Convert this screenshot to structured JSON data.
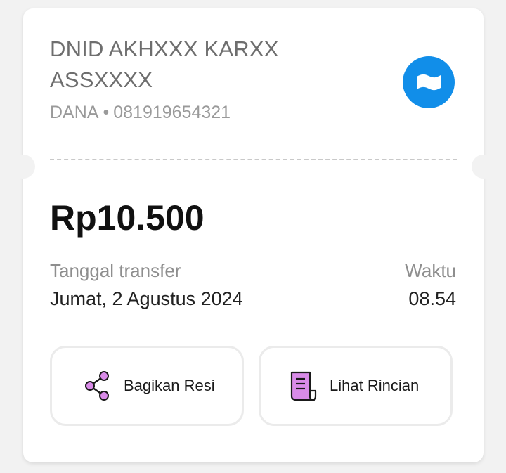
{
  "recipient": {
    "name": "DNID AKHXXX KARXX ASSXXXX",
    "wallet": "DANA",
    "separator": "•",
    "phone": "081919654321",
    "logo_icon": "dana-wallet-icon",
    "logo_color": "#118ee9"
  },
  "transfer": {
    "amount": "Rp10.500",
    "date_label": "Tanggal transfer",
    "date_value": "Jumat, 2 Agustus 2024",
    "time_label": "Waktu",
    "time_value": "08.54"
  },
  "actions": {
    "share": {
      "label": "Bagikan Resi",
      "icon": "share-icon"
    },
    "detail": {
      "label": "Lihat Rincian",
      "icon": "receipt-icon"
    },
    "icon_color": "#d98be8"
  }
}
